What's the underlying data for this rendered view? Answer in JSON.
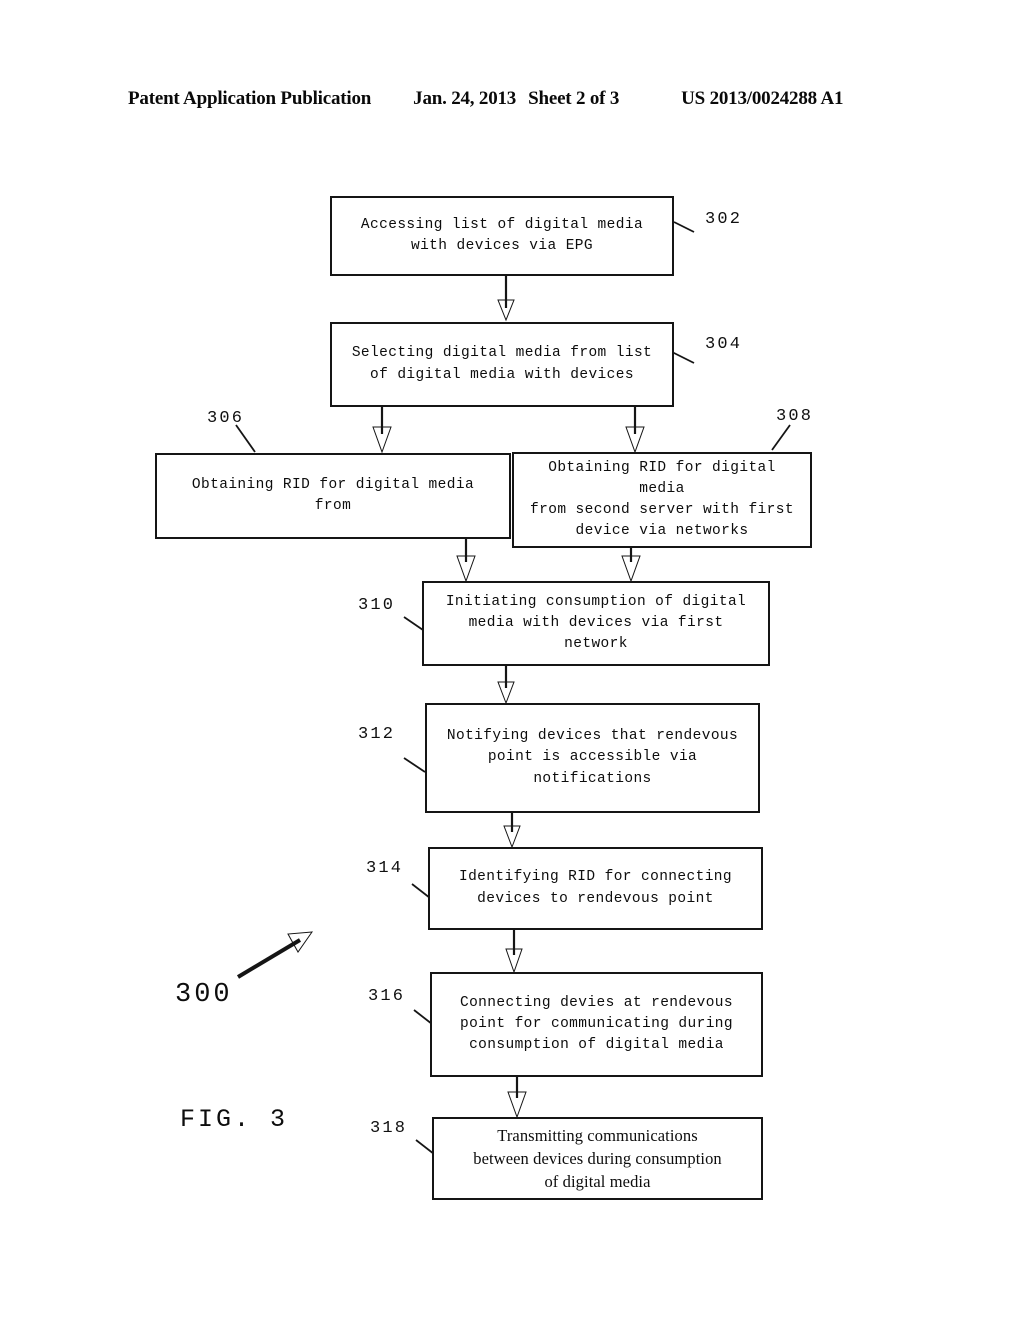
{
  "header": {
    "publication": "Patent Application Publication",
    "date": "Jan. 24, 2013",
    "sheet": "Sheet 2 of 3",
    "patent_number": "US 2013/0024288 A1"
  },
  "figure": {
    "label": "FIG. 3",
    "flow_id": "300"
  },
  "flow": {
    "steps": [
      {
        "ref": "302",
        "text": "Accessing list of digital media\nwith devices via EPG"
      },
      {
        "ref": "304",
        "text": "Selecting digital media from list\nof digital media with devices"
      },
      {
        "ref": "306",
        "text": "Obtaining RID for digital media\nfrom"
      },
      {
        "ref": "308",
        "text": "Obtaining RID for digital media\nfrom second server with first\ndevice via networks"
      },
      {
        "ref": "310",
        "text": "Initiating consumption of digital\nmedia with devices via first network"
      },
      {
        "ref": "312",
        "text": "Notifying devices that rendevous\npoint is accessible via\nnotifications"
      },
      {
        "ref": "314",
        "text": "Identifying RID for connecting\ndevices to rendevous point"
      },
      {
        "ref": "316",
        "text": "Connecting devies at rendevous\npoint for communicating during\nconsumption of digital media"
      },
      {
        "ref": "318",
        "text": "Transmitting communications\nbetween devices during consumption\nof digital media"
      }
    ]
  },
  "colors": {
    "ink": "#151515",
    "paper": "#ffffff"
  }
}
